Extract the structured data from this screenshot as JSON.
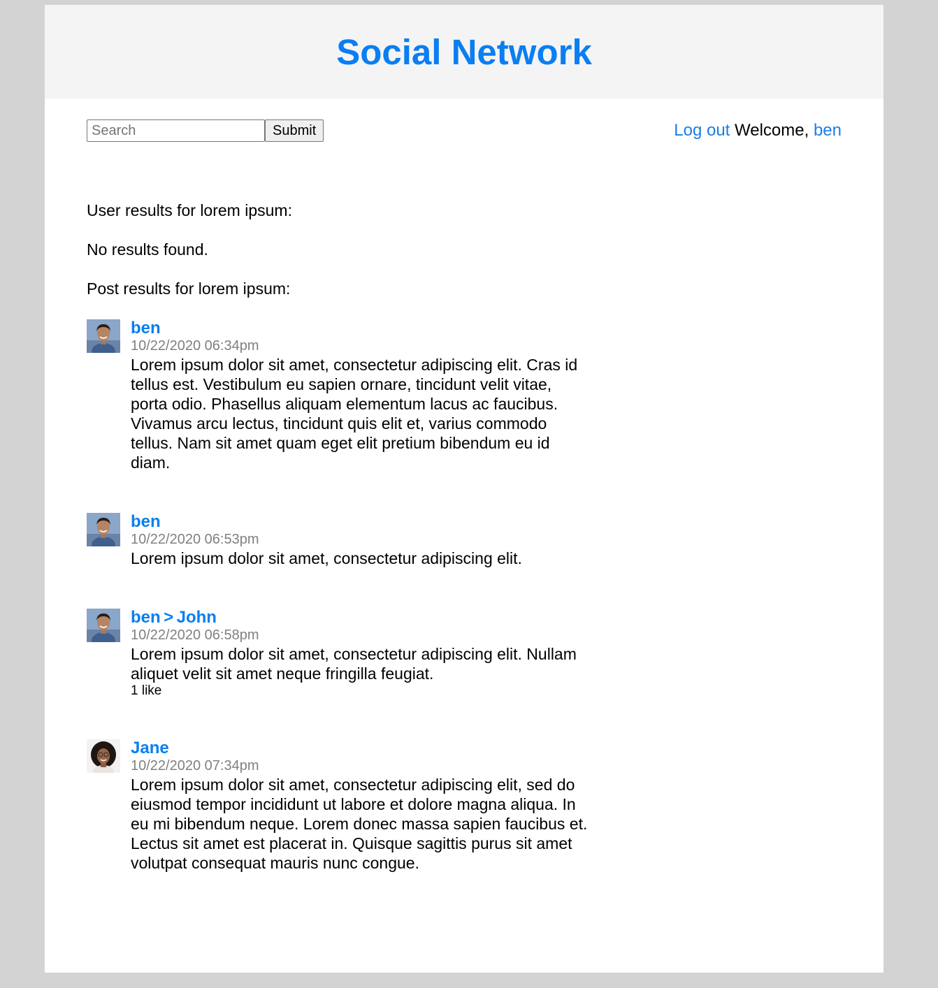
{
  "header": {
    "title": "Social Network"
  },
  "search": {
    "placeholder": "Search",
    "value": "",
    "submit_label": "Submit"
  },
  "user_area": {
    "logout_label": "Log out",
    "welcome_text": "Welcome,",
    "username": "ben"
  },
  "results": {
    "user_heading": "User results for lorem ipsum:",
    "user_empty": "No results found.",
    "post_heading": "Post results for lorem ipsum:"
  },
  "posts": [
    {
      "author": "ben",
      "recipient": "",
      "timestamp": "10/22/2020 06:34pm",
      "body": "Lorem ipsum dolor sit amet, consectetur adipiscing elit. Cras id tellus est. Vestibulum eu sapien ornare, tincidunt velit vitae, porta odio. Phasellus aliquam elementum lacus ac faucibus. Vivamus arcu lectus, tincidunt quis elit et, varius commodo tellus. Nam sit amet quam eget elit pretium bibendum eu id diam.",
      "likes": "",
      "avatar": "ben-avatar"
    },
    {
      "author": "ben",
      "recipient": "",
      "timestamp": "10/22/2020 06:53pm",
      "body": "Lorem ipsum dolor sit amet, consectetur adipiscing elit.",
      "likes": "",
      "avatar": "ben-avatar"
    },
    {
      "author": "ben",
      "recipient": "John",
      "separator": ">",
      "timestamp": "10/22/2020 06:58pm",
      "body": "Lorem ipsum dolor sit amet, consectetur adipiscing elit. Nullam aliquet velit sit amet neque fringilla feugiat.",
      "likes": "1 like",
      "avatar": "ben-avatar"
    },
    {
      "author": "Jane",
      "recipient": "",
      "timestamp": "10/22/2020 07:34pm",
      "body": "Lorem ipsum dolor sit amet, consectetur adipiscing elit, sed do eiusmod tempor incididunt ut labore et dolore magna aliqua. In eu mi bibendum neque. Lorem donec massa sapien faucibus et. Lectus sit amet est placerat in. Quisque sagittis purus sit amet volutpat consequat mauris nunc congue.",
      "likes": "",
      "avatar": "jane-avatar"
    }
  ],
  "colors": {
    "accent": "#0a7ef2",
    "link": "#1a7ee6",
    "header_bg": "#f4f4f4",
    "page_bg": "#d3d3d3",
    "timestamp": "#808080"
  }
}
